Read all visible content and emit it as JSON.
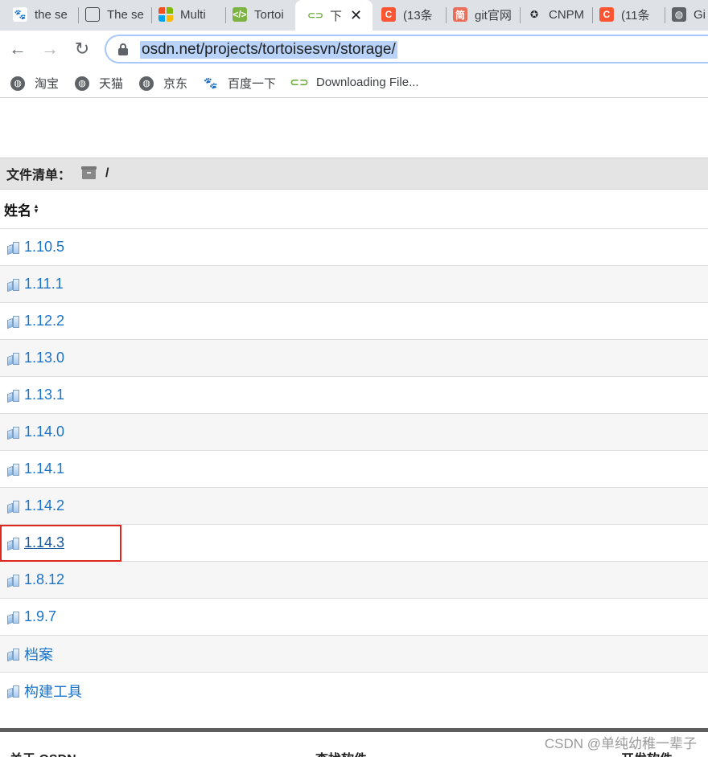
{
  "tabs": [
    {
      "favicon": "baidu-paw-icon",
      "title": "the se"
    },
    {
      "favicon": "rst-icon",
      "title": "The se"
    },
    {
      "favicon": "microsoft-icon",
      "title": "Multi"
    },
    {
      "favicon": "tortoisesvn-icon",
      "title": "Tortoi"
    },
    {
      "favicon": "osdn-icon",
      "title": "下",
      "active": true,
      "close": "✕"
    },
    {
      "favicon": "csdn-icon",
      "title": "(13条"
    },
    {
      "favicon": "jianshu-icon",
      "title": "git官网"
    },
    {
      "favicon": "cnpm-icon",
      "title": "CNPM"
    },
    {
      "favicon": "csdn-icon",
      "title": "(11条"
    },
    {
      "favicon": "globe-icon",
      "title": "Gi"
    }
  ],
  "toolbar": {
    "back": "←",
    "forward": "→",
    "reload": "↻",
    "url": "osdn.net/projects/tortoisesvn/storage/"
  },
  "bookmarks": [
    {
      "icon": "globe-icon",
      "label": "淘宝"
    },
    {
      "icon": "globe-icon",
      "label": "天猫"
    },
    {
      "icon": "globe-icon",
      "label": "京东"
    },
    {
      "icon": "baidu-paw-icon",
      "label": "百度一下"
    },
    {
      "icon": "osdn-icon",
      "label": "Downloading File..."
    }
  ],
  "listing": {
    "header_label": "文件清单：",
    "path": "/",
    "column_name": "姓名",
    "files": [
      "1.10.5",
      "1.11.1",
      "1.12.2",
      "1.13.0",
      "1.13.1",
      "1.14.0",
      "1.14.1",
      "1.14.2",
      "1.14.3",
      "1.8.12",
      "1.9.7",
      "档案",
      "构建工具"
    ],
    "hovered_file": "1.14.3"
  },
  "footer": {
    "col1": "关于 OSDN",
    "col2": "查找软件",
    "col3": "开发软件"
  },
  "watermark": "CSDN @单纯幼稚一辈子",
  "colors": {
    "link": "#1a73c8",
    "highlight_border": "#e0271d",
    "url_selection": "#b8d3f7"
  }
}
